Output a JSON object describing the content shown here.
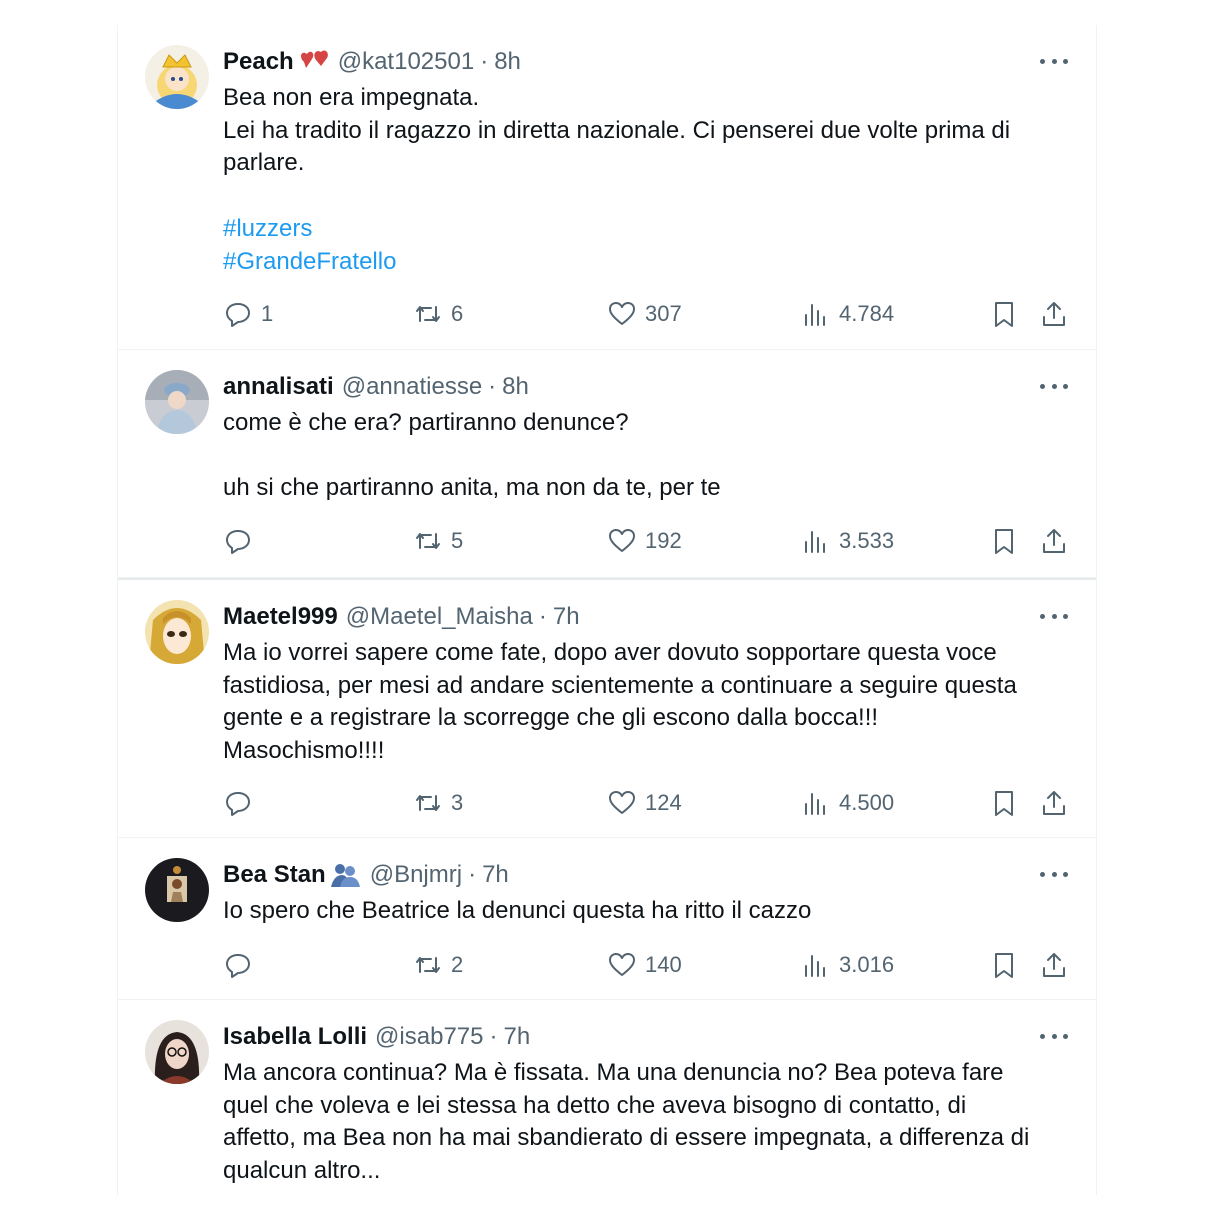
{
  "tweets": [
    {
      "name": "Peach",
      "handle": "@kat102501",
      "time": "8h",
      "avatar_icon": "peach-avatar",
      "emoji_icon": "two-hearts-icon",
      "lines": [
        "Bea non era impegnata.",
        "Lei ha tradito il ragazzo in diretta nazionale. Ci penserei due volte prima di",
        "parlare.",
        "",
        "#luzzers",
        "#GrandeFratello"
      ],
      "replies": "1",
      "retweets": "6",
      "likes": "307",
      "views": "4.784"
    },
    {
      "name": "annalisati",
      "handle": "@annatiesse",
      "time": "8h",
      "avatar_icon": "queen-avatar",
      "lines": [
        "come è che era? partiranno denunce?",
        "",
        "uh si che partiranno anita, ma non da te, per te"
      ],
      "replies": "",
      "retweets": "5",
      "likes": "192",
      "views": "3.533"
    },
    {
      "name": "Maetel999",
      "handle": "@Maetel_Maisha",
      "time": "7h",
      "avatar_icon": "anime-avatar",
      "lines": [
        "Ma io vorrei sapere come fate, dopo aver dovuto sopportare questa voce",
        "fastidiosa, per mesi ad andare scientemente a continuare a seguire questa",
        "gente e a registrare la scorregge che gli escono dalla bocca!!!",
        "Masochismo!!!!"
      ],
      "replies": "",
      "retweets": "3",
      "likes": "124",
      "views": "4.500"
    },
    {
      "name": "Bea Stan",
      "handle": "@Bnjmrj",
      "time": "7h",
      "avatar_icon": "photo-avatar",
      "emoji_icon": "hugging-people-icon",
      "lines": [
        "Io spero che Beatrice la denunci questa ha ritto il cazzo"
      ],
      "replies": "",
      "retweets": "2",
      "likes": "140",
      "views": "3.016"
    },
    {
      "name": "Isabella Lolli",
      "handle": "@isab775",
      "time": "7h",
      "avatar_icon": "woman-glasses-avatar",
      "lines": [
        "Ma ancora continua? Ma è fissata. Ma una denuncia no? Bea poteva fare",
        "quel che voleva e lei stessa ha detto che aveva bisogno di contatto, di",
        "affetto, ma Bea non ha mai sbandierato di essere impegnata, a differenza di",
        "qualcun altro..."
      ]
    }
  ],
  "colors": {
    "text": "#0f1419",
    "secondary": "#536471",
    "link": "#1d9bf0",
    "divider": "#eff3f4"
  }
}
